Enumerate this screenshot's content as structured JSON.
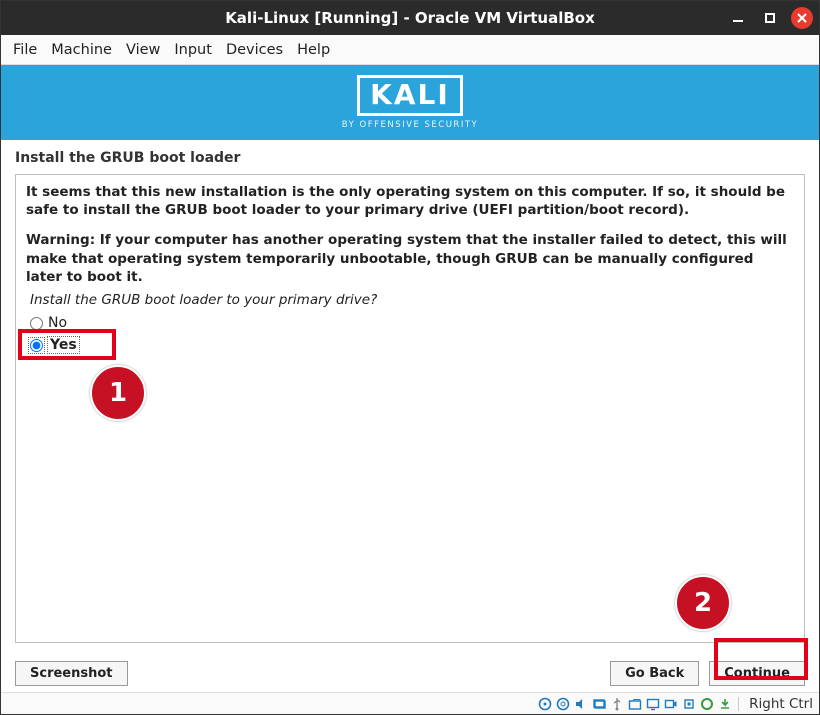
{
  "window": {
    "title": "Kali-Linux [Running] - Oracle VM VirtualBox"
  },
  "menubar": [
    "File",
    "Machine",
    "View",
    "Input",
    "Devices",
    "Help"
  ],
  "banner": {
    "logo": "KALI",
    "subtitle": "BY OFFENSIVE SECURITY"
  },
  "content": {
    "section_title": "Install the GRUB boot loader",
    "para1": "It seems that this new installation is the only operating system on this computer. If so, it should be safe to install the GRUB boot loader to your primary drive (UEFI partition/boot record).",
    "para2": "Warning: If your computer has another operating system that the installer failed to detect, this will make that operating system temporarily unbootable, though GRUB can be manually configured later to boot it.",
    "question": "Install the GRUB boot loader to your primary drive?",
    "opt_no": "No",
    "opt_yes": "Yes"
  },
  "footer": {
    "screenshot": "Screenshot",
    "goback": "Go Back",
    "continue": "Continue"
  },
  "markers": {
    "one": "1",
    "two": "2"
  },
  "statusbar": {
    "host_key": "Right Ctrl"
  }
}
